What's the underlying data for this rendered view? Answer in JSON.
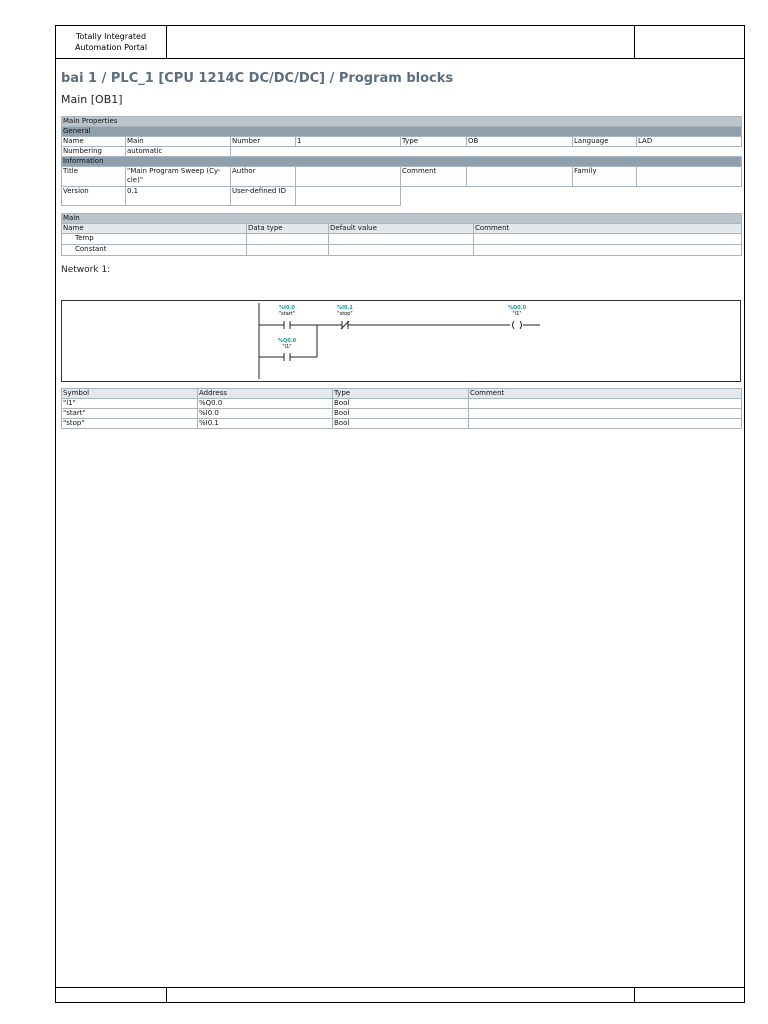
{
  "header": {
    "portal_line1": "Totally Integrated",
    "portal_line2": "Automation Portal"
  },
  "breadcrumb": "bai 1 / PLC_1 [CPU 1214C DC/DC/DC] / Program blocks",
  "block_title": "Main [OB1]",
  "properties": {
    "section": "Main Properties",
    "general": "General",
    "name_label": "Name",
    "name": "Main",
    "number_label": "Number",
    "number": "1",
    "type_label": "Type",
    "type": "OB",
    "language_label": "Language",
    "language": "LAD",
    "numbering_label": "Numbering",
    "numbering": "automatic",
    "information": "Information",
    "title_label": "Title",
    "title": "\"Main Program Sweep (Cy-cle)\"",
    "author_label": "Author",
    "author": "",
    "comment_label": "Comment",
    "comment": "",
    "family_label": "Family",
    "family": "",
    "version_label": "Version",
    "version": "0.1",
    "userid_label": "User-defined ID",
    "userid": ""
  },
  "interface": {
    "section": "Main",
    "columns": [
      "Name",
      "Data type",
      "Default value",
      "Comment"
    ],
    "rows": [
      "Temp",
      "Constant"
    ]
  },
  "network": {
    "title": "Network 1:",
    "contact1": {
      "address": "%I0.0",
      "symbol": "\"start\""
    },
    "contact2": {
      "address": "%I0.1",
      "symbol": "\"stop\""
    },
    "coil": {
      "address": "%Q0.0",
      "symbol": "\"l1\""
    },
    "contact3": {
      "address": "%Q0.0",
      "symbol": "\"l1\""
    }
  },
  "symbols": {
    "columns": [
      "Symbol",
      "Address",
      "Type",
      "Comment"
    ],
    "rows": [
      [
        "\"l1\"",
        "%Q0.0",
        "Bool",
        ""
      ],
      [
        "\"start\"",
        "%I0.0",
        "Bool",
        ""
      ],
      [
        "\"stop\"",
        "%I0.1",
        "Bool",
        ""
      ]
    ]
  },
  "colors": {
    "header_band": "#b9c4cc",
    "section_band": "#8fa0ac",
    "title": "#5a6e80",
    "address": "#1a9a9a"
  }
}
